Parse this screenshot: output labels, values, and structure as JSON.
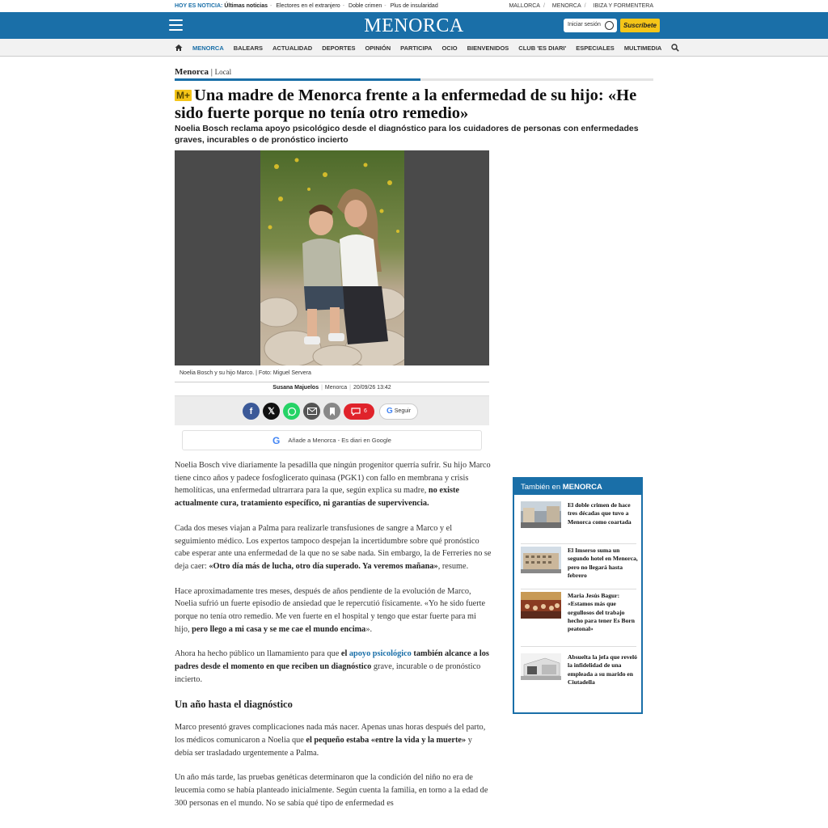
{
  "ticker": {
    "label": "HOY ES NOTICIA:",
    "items": [
      "Últimas noticias",
      "Electores en el extranjero",
      "Doble crimen",
      "Plus de insularidad"
    ],
    "regions": [
      "MALLORCA",
      "MENORCA",
      "IBIZA Y FORMENTERA"
    ]
  },
  "header": {
    "logo": "MENORCA",
    "login": "Iniciar sesión",
    "subscribe": "Suscríbete"
  },
  "nav": [
    "MENORCA",
    "BALEARS",
    "ACTUALIDAD",
    "DEPORTES",
    "OPINIÓN",
    "PARTICIPA",
    "OCIO",
    "BIENVENIDOS",
    "CLUB 'ES DIARI'",
    "ESPECIALES",
    "MULTIMEDIA"
  ],
  "breadcrumb": {
    "section": "Menorca",
    "sub": "Local"
  },
  "article": {
    "badge": "M+",
    "title": "Una madre de Menorca frente a la enfermedad de su hijo: «He sido fuerte porque no tenía otro remedio»",
    "subtitle": "Noelia Bosch reclama apoyo psicológico desde el diagnóstico para los cuidadores de personas con enfermedades graves, incurables o de pronóstico incierto",
    "caption": "Noelia Bosch y su hijo Marco. | Foto: Miguel Servera",
    "author": "Susana Majuelos",
    "location": "Menorca",
    "date": "20/09/26 13:42",
    "comments": "6",
    "follow": "Seguir",
    "google_add": "Añade a Menorca - Es diari en Google",
    "p1a": "Noelia Bosch vive diariamente la pesadilla que ningún progenitor querría sufrir. Su hijo Marco tiene cinco años y padece fosfoglicerato quinasa (PGK1) con fallo en membrana y crisis hemolíticas, una enfermedad ultrarrara para la que, según explica su madre, ",
    "p1b": "no existe actualmente cura, tratamiento específico, ni garantías de supervivencia.",
    "p2a": "Cada dos meses viajan a Palma para realizarle transfusiones de sangre a Marco y el seguimiento médico. Los expertos tampoco despejan la incertidumbre sobre qué pronóstico cabe esperar ante una enfermedad de la que no se sabe nada. Sin embargo, la de Ferreries no se deja caer: ",
    "p2b": "«Otro día más de lucha, otro día superado. Ya veremos mañana»",
    "p2c": ", resume.",
    "p3a": "Hace aproximadamente tres meses, después de años pendiente de la evolución de Marco, Noelia sufrió un fuerte episodio de ansiedad que le repercutió físicamente. «Yo he sido fuerte porque no tenía otro remedio. Me ven fuerte en el hospital y tengo que estar fuerte para mi hijo, ",
    "p3b": "pero llego a mi casa y se me cae el mundo encima",
    "p3c": "».",
    "p4a": "Ahora ha hecho público un llamamiento para que ",
    "p4b": "el ",
    "p4link": "apoyo psicológico",
    "p4c": " también alcance a los padres desde el momento en que reciben un diagnóstico",
    "p4d": " grave, incurable o de pronóstico incierto.",
    "h2": "Un año hasta el diagnóstico",
    "p5a": "Marco presentó graves complicaciones nada más nacer. Apenas unas horas después del parto, los médicos comunicaron a Noelia que ",
    "p5b": "el pequeño estaba «entre la vida y la muerte»",
    "p5c": " y debía ser trasladado urgentemente a Palma.",
    "p6": "Un año más tarde, las pruebas genéticas  determinaron que la condición del niño no era de leucemia como se había planteado inicialmente. Según cuenta la familia, en torno a la edad de 300 personas en el mundo. No se sabía qué tipo de enfermedad es"
  },
  "sidebar": {
    "head_pre": "También en",
    "head_brand": "MENORCA",
    "items": [
      "El doble crimen de hace tres décadas que tuvo a Menorca como coartada",
      "El Imserso suma un segundo hotel en Menorca, pero no llegará hasta febrero",
      "Maria Jesús Bagur: «Estamos más que orgullosos del trabajo hecho para tener Es Born peatonal»",
      "Absuelta la jefa que reveló la infidelidad de una empleada a su marido en Ciutadella"
    ]
  },
  "colors": {
    "brand": "#1a6fa8",
    "accent": "#f5c518",
    "comment": "#e0232b"
  }
}
